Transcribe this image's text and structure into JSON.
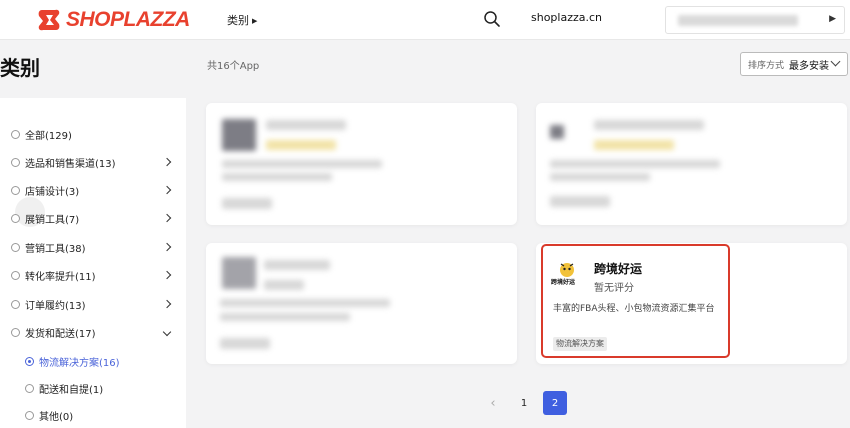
{
  "header": {
    "logo_text": "SHOPLAZZA",
    "nav_category": "类别",
    "domain": "shoplazza.cn",
    "brand_color": "#e8412e"
  },
  "main": {
    "title": "类别",
    "app_count": "共16个App",
    "sort_label": "排序方式",
    "sort_value": "最多安装"
  },
  "sidebar": {
    "items": [
      {
        "label": "全部(129)"
      },
      {
        "label": "选品和销售渠道(13)"
      },
      {
        "label": "店铺设计(3)"
      },
      {
        "label": "展销工具(7)"
      },
      {
        "label": "营销工具(38)"
      },
      {
        "label": "转化率提升(11)"
      },
      {
        "label": "订单履约(13)"
      },
      {
        "label": "发货和配送(17)"
      }
    ],
    "sub_items": [
      {
        "label": "物流解决方案(16)",
        "selected": true
      },
      {
        "label": "配送和自提(1)",
        "selected": false
      }
    ],
    "last_item": {
      "label": "其他(0)"
    }
  },
  "featured_app": {
    "name": "跨境好运",
    "rating": "暂无评分",
    "description": "丰富的FBA头程、小包物流资源汇集平台",
    "tag": "物流解决方案",
    "icon_text": "跨境好运"
  },
  "pagination": {
    "pages": [
      "1",
      "2"
    ],
    "current": "2",
    "accent_color": "#3f5fe0"
  }
}
